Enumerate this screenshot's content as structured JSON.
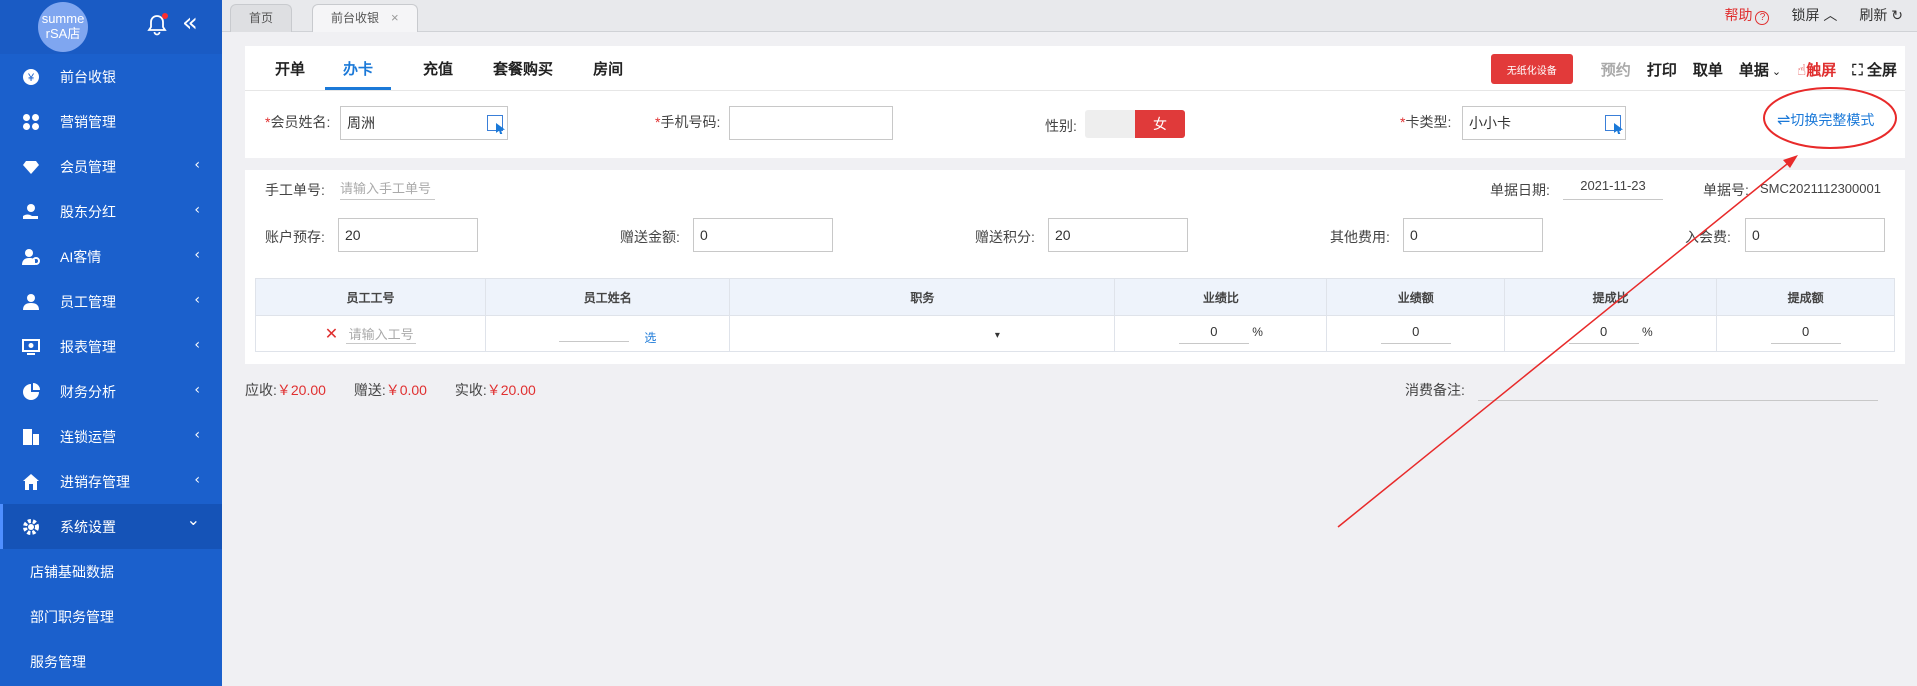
{
  "sidebar": {
    "avatar_text": "summe rSA店",
    "items": [
      {
        "label": "前台收银",
        "icon": "yen-icon",
        "arrow": false
      },
      {
        "label": "营销管理",
        "icon": "grid-icon",
        "arrow": false
      },
      {
        "label": "会员管理",
        "icon": "diamond-icon",
        "arrow": true
      },
      {
        "label": "股东分红",
        "icon": "hand-coin-icon",
        "arrow": true
      },
      {
        "label": "AI客情",
        "icon": "user-gear-icon",
        "arrow": true
      },
      {
        "label": "员工管理",
        "icon": "user-icon",
        "arrow": true
      },
      {
        "label": "报表管理",
        "icon": "monitor-icon",
        "arrow": true
      },
      {
        "label": "财务分析",
        "icon": "pie-icon",
        "arrow": true
      },
      {
        "label": "连锁运营",
        "icon": "building-icon",
        "arrow": true
      },
      {
        "label": "进销存管理",
        "icon": "house-icon",
        "arrow": true
      },
      {
        "label": "系统设置",
        "icon": "gear-icon",
        "arrow": true
      }
    ],
    "sub_items": [
      "店铺基础数据",
      "部门职务管理",
      "服务管理"
    ],
    "arrow_glyph": "‹",
    "down_glyph": "⌄"
  },
  "tabbar": {
    "tabs": [
      {
        "label": "首页"
      },
      {
        "label": "前台收银"
      }
    ],
    "close_glyph": "×",
    "help": "帮助",
    "help_q": "?",
    "lock": "锁屏",
    "refresh": "刷新"
  },
  "subtabs": [
    "开单",
    "办卡",
    "充值",
    "套餐购买",
    "房间"
  ],
  "toolbar": {
    "paperless": "无纸化设备",
    "reserve": "预约",
    "print": "打印",
    "fetch": "取单",
    "docs": "单据",
    "touch": "触屏",
    "fullscreen": "全屏"
  },
  "form": {
    "member_name_label": "会员姓名:",
    "member_name_value": "周洲",
    "phone_label": "手机号码:",
    "phone_value": "",
    "gender_label": "性别:",
    "gender_value": "女",
    "card_type_label": "卡类型:",
    "card_type_value": "小小卡",
    "switch_full": "切换完整模式"
  },
  "detail": {
    "manual_no_label": "手工单号:",
    "manual_no_placeholder": "请输入手工单号",
    "date_label": "单据日期:",
    "date_value": "2021-11-23",
    "bill_no_label": "单据号:",
    "bill_no_value": "SMC2021112300001",
    "prepay_label": "账户预存:",
    "prepay_value": "20",
    "gift_amount_label": "赠送金额:",
    "gift_amount_value": "0",
    "gift_points_label": "赠送积分:",
    "gift_points_value": "20",
    "other_fee_label": "其他费用:",
    "other_fee_value": "0",
    "join_fee_label": "入会费:",
    "join_fee_value": "0"
  },
  "staff_table": {
    "headers": [
      "员工工号",
      "员工姓名",
      "职务",
      "业绩比",
      "业绩额",
      "提成比",
      "提成额"
    ],
    "row": {
      "staff_no_placeholder": "请输入工号",
      "select_label": "选",
      "perf_ratio": "0",
      "perf_amount": "0",
      "comm_ratio": "0",
      "comm_amount": "0",
      "percent": "%",
      "dropdown_glyph": "▾"
    }
  },
  "totals": {
    "receivable_label": "应收:",
    "receivable_value": "￥20.00",
    "gift_label": "赠送:",
    "gift_value": "￥0.00",
    "actual_label": "实收:",
    "actual_value": "￥20.00",
    "remark_label": "消费备注:"
  },
  "colors": {
    "sidebar": "#1b60cc",
    "accent": "#1b79d8",
    "red": "#e03030"
  }
}
